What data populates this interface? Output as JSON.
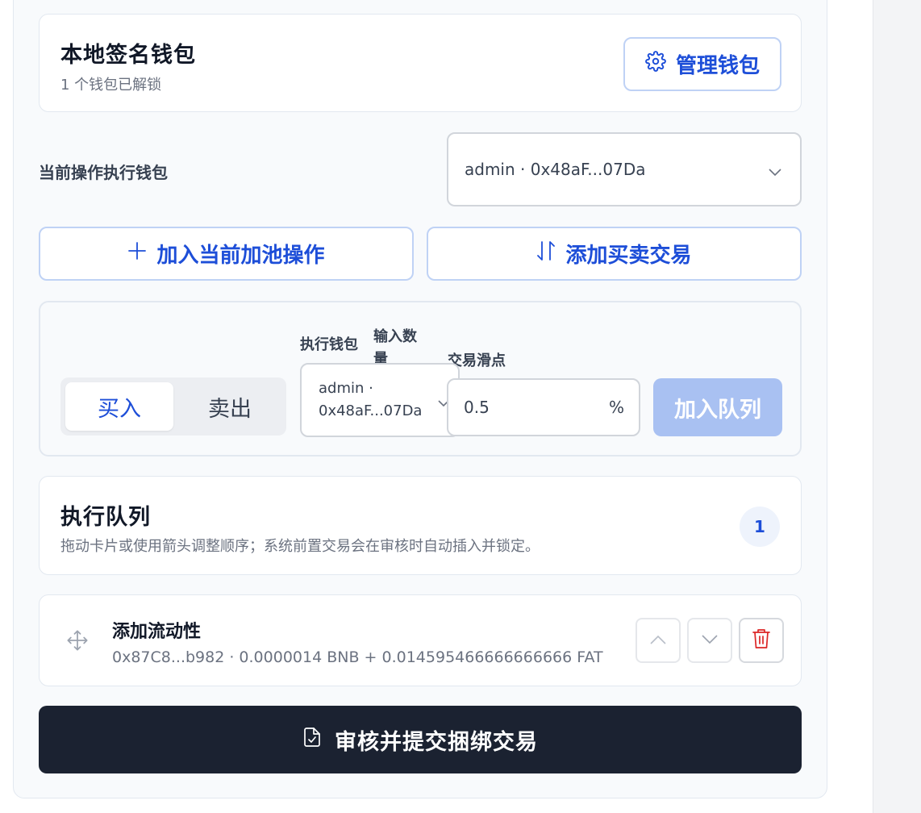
{
  "wallet": {
    "title": "本地签名钱包",
    "subtitle": "1 个钱包已解锁",
    "manage_label": "管理钱包"
  },
  "exec_wallet": {
    "label": "当前操作执行钱包",
    "selected": "admin · 0x48aF...07Da"
  },
  "actions": {
    "add_pool_label": "加入当前加池操作",
    "add_trade_label": "添加买卖交易"
  },
  "trade": {
    "buy_label": "买入",
    "sell_label": "卖出",
    "active_side": "buy",
    "wallet_label": "执行钱包",
    "wallet_selected_line1": "admin ·",
    "wallet_selected_line2": "0x48aF...07Da",
    "amount_label": "输入数量",
    "slippage_label": "交易滑点",
    "slippage_value": "0.5",
    "slippage_unit": "%",
    "add_queue_label": "加入队列"
  },
  "queue": {
    "title": "执行队列",
    "description": "拖动卡片或使用箭头调整顺序；系统前置交易会在审核时自动插入并锁定。",
    "count": "1",
    "items": [
      {
        "title": "添加流动性",
        "detail": "0x87C8...b982 · 0.0000014 BNB + 0.014595466666666666 FAT"
      }
    ]
  },
  "submit_label": "审核并提交捆绑交易",
  "colors": {
    "accent": "#1d4ed8",
    "accent_disabled": "#a9c1f2",
    "submit_bg": "#1b2231",
    "delete": "#dc2626"
  },
  "icons": {
    "manage": "gear-icon",
    "add_pool": "plus-icon",
    "add_trade": "swap-vertical-icon",
    "drag": "move-icon",
    "up": "chevron-up-icon",
    "down": "chevron-down-icon",
    "delete": "trash-icon",
    "submit": "file-check-icon"
  }
}
